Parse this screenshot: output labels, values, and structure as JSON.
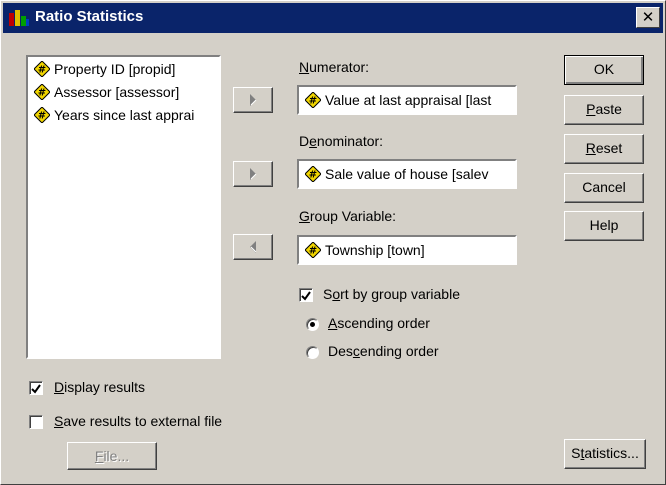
{
  "window": {
    "title": "Ratio Statistics",
    "close_glyph": "✕"
  },
  "variables_list": [
    {
      "label": "Property ID [propid]",
      "icon": "numeric-variable-icon"
    },
    {
      "label": "Assessor [assessor]",
      "icon": "numeric-variable-icon"
    },
    {
      "label": "Years since last apprai",
      "icon": "numeric-variable-icon"
    }
  ],
  "numerator": {
    "label_mnemonic": "N",
    "label_rest": "umerator:",
    "value": "Value at last appraisal [last"
  },
  "denominator": {
    "label_pre": "D",
    "label_mnemonic": "e",
    "label_rest": "nominator:",
    "value": "Sale value of house [salev"
  },
  "group_variable": {
    "label_mnemonic": "G",
    "label_rest": "roup Variable:",
    "value": "Township [town]"
  },
  "sort_by_group": {
    "label_pre": "S",
    "label_mnemonic": "o",
    "label_rest": "rt by group variable",
    "checked": true
  },
  "ascending": {
    "label_mnemonic": "A",
    "label_rest": "scending order",
    "selected": true
  },
  "descending": {
    "label_pre": "Des",
    "label_mnemonic": "c",
    "label_rest": "ending order",
    "selected": false
  },
  "display_results": {
    "label_mnemonic": "D",
    "label_rest": "isplay results",
    "checked": true
  },
  "save_results": {
    "label_mnemonic": "S",
    "label_rest": "ave results to external file",
    "checked": false
  },
  "file_button": {
    "label_mnemonic": "F",
    "label_rest": "ile...",
    "enabled": false
  },
  "buttons": {
    "ok": "OK",
    "paste_mnemonic": "P",
    "paste_rest": "aste",
    "reset_mnemonic": "R",
    "reset_rest": "eset",
    "cancel": "Cancel",
    "help": "Help",
    "statistics_pre": "S",
    "statistics_mnemonic": "t",
    "statistics_rest": "atistics..."
  },
  "colors": {
    "titlebar": "#0a246a",
    "face": "#d4d0c8",
    "variable_icon": "#f2d600"
  }
}
